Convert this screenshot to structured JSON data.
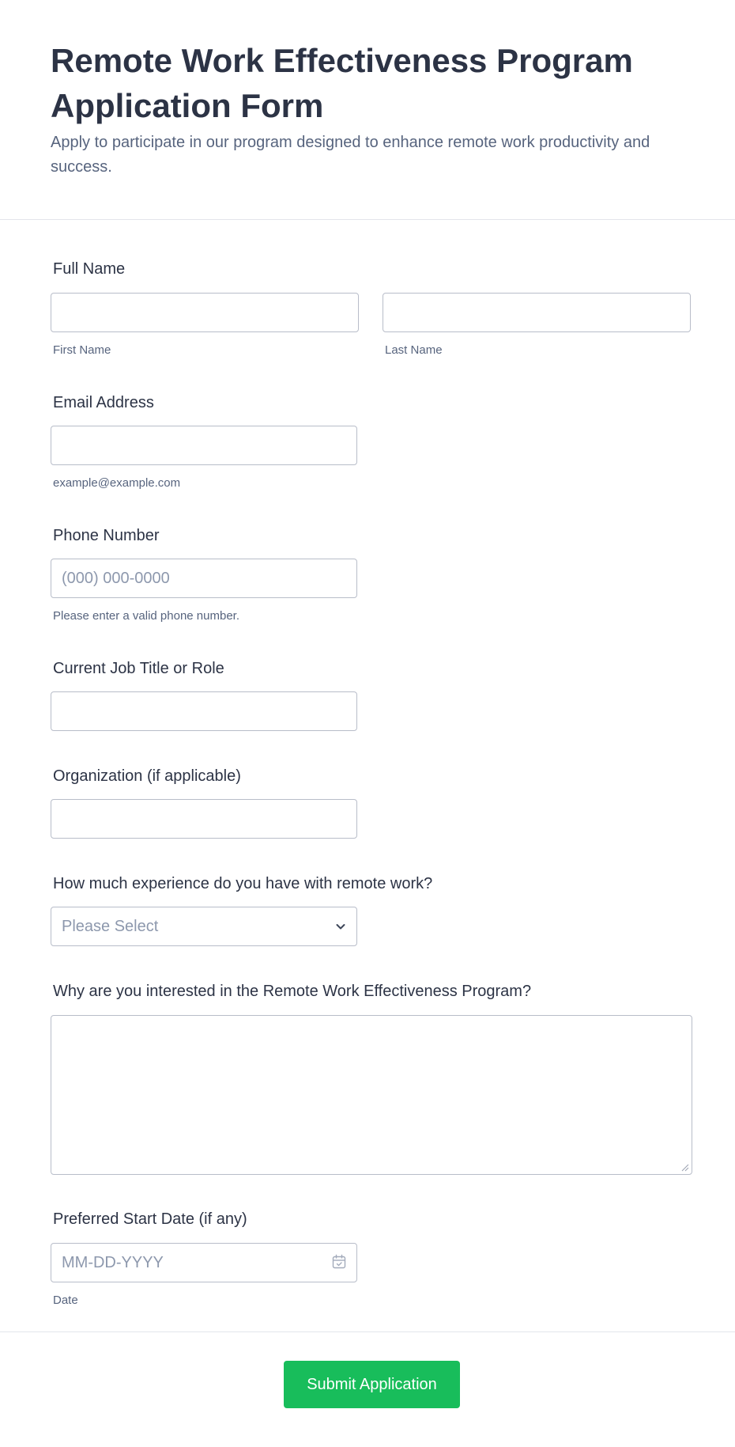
{
  "form": {
    "title": "Remote Work Effectiveness Program Application Form",
    "subtitle": "Apply to participate in our program designed to enhance remote work productivity and success."
  },
  "fields": {
    "full_name": {
      "label": "Full Name",
      "first_sublabel": "First Name",
      "last_sublabel": "Last Name",
      "first_value": "",
      "last_value": ""
    },
    "email": {
      "label": "Email Address",
      "sublabel": "example@example.com",
      "value": ""
    },
    "phone": {
      "label": "Phone Number",
      "placeholder": "(000) 000-0000",
      "sublabel": "Please enter a valid phone number.",
      "value": ""
    },
    "job_title": {
      "label": "Current Job Title or Role",
      "value": ""
    },
    "organization": {
      "label": "Organization (if applicable)",
      "value": ""
    },
    "experience": {
      "label": "How much experience do you have with remote work?",
      "selected": "Please Select"
    },
    "interest": {
      "label": "Why are you interested in the Remote Work Effectiveness Program?",
      "value": ""
    },
    "start_date": {
      "label": "Preferred Start Date (if any)",
      "placeholder": "MM-DD-YYYY",
      "sublabel": "Date",
      "value": ""
    }
  },
  "submit": {
    "label": "Submit Application",
    "color": "#18bd5b"
  },
  "icons": {
    "select": "chevron-down-icon",
    "date": "calendar-icon",
    "textarea": "resize-grip-icon"
  }
}
